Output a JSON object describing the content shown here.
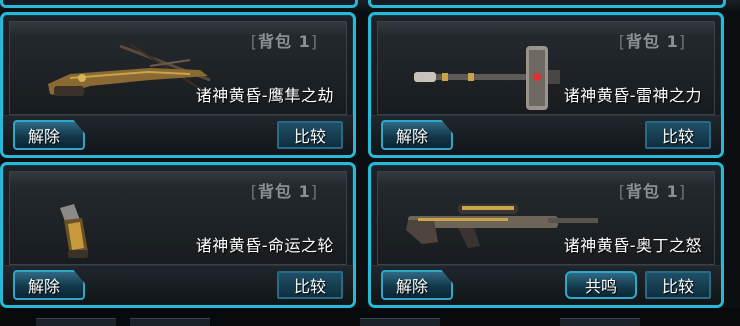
{
  "cards": [
    {
      "bag_label": "背包 1",
      "weapon_name": "诸神黄昏-鹰隼之劫",
      "weapon_icon": "crossbow-icon",
      "release_label": "解除",
      "compare_label": "比较"
    },
    {
      "bag_label": "背包 1",
      "weapon_name": "诸神黄昏-雷神之力",
      "weapon_icon": "hammer-icon",
      "release_label": "解除",
      "compare_label": "比较"
    },
    {
      "bag_label": "背包 1",
      "weapon_name": "诸神黄昏-命运之轮",
      "weapon_icon": "grenade-icon",
      "release_label": "解除",
      "compare_label": "比较"
    },
    {
      "bag_label": "背包 1",
      "weapon_name": "诸神黄昏-奥丁之怒",
      "weapon_icon": "sniper-rifle-icon",
      "release_label": "解除",
      "resonance_label": "共鸣",
      "compare_label": "比较"
    }
  ],
  "colors": {
    "accent_border": "#29b9d8",
    "button_fill": "#12384a",
    "text": "#ffffff",
    "bag_tag": "#8a9095"
  }
}
